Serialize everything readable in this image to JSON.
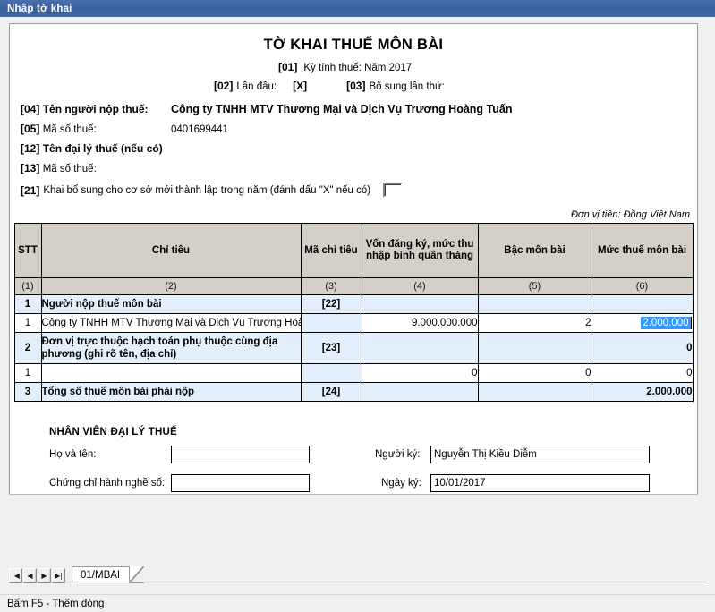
{
  "window": {
    "title": "Nhập tờ khai"
  },
  "form": {
    "title": "TỜ KHAI THUẾ MÔN BÀI",
    "line01": {
      "code": "[01]",
      "text": "Kỳ tính thuế: Năm 2017"
    },
    "line02": {
      "code": "[02]",
      "label": "Lần đầu:",
      "value": "[X]",
      "code03": "[03]",
      "label03": "Bổ sung lần thứ:",
      "value03": ""
    },
    "rows": [
      {
        "code": "[04]",
        "label": "Tên người nộp thuế:",
        "value": "Công ty TNHH MTV Thương Mại và Dịch Vụ Trương Hoàng Tuấn",
        "bold_label": true,
        "bold_value": true
      },
      {
        "code": "[05]",
        "label": "Mã số thuế:",
        "value": "0401699441",
        "bold_label": false,
        "bold_value": false
      },
      {
        "code": "[12]",
        "label": "Tên đại lý thuế (nếu có)",
        "value": "",
        "bold_label": true,
        "bold_value": false
      },
      {
        "code": "[13]",
        "label": "Mã số thuế:",
        "value": "",
        "bold_label": false,
        "bold_value": false
      }
    ],
    "row21": {
      "code": "[21]",
      "text": "Khai bổ sung cho cơ sở mới thành lập trong năm (đánh dấu \"X\" nếu có)",
      "checked": false
    },
    "currency_note": "Đơn vị tiền: Đồng Việt Nam"
  },
  "table": {
    "headers": [
      "STT",
      "Chỉ tiêu",
      "Mã chỉ tiêu",
      "Vốn đăng ký, mức thu nhập bình quân tháng",
      "Bậc môn bài",
      "Mức thuế môn bài"
    ],
    "numbering": [
      "(1)",
      "(2)",
      "(3)",
      "(4)",
      "(5)",
      "(6)"
    ],
    "rows": [
      {
        "kind": "group",
        "stt": "1",
        "name": "Người nộp thuế môn bài",
        "code": "[22]",
        "capital": "",
        "grade": "",
        "tax": ""
      },
      {
        "kind": "detail",
        "stt": "1",
        "name": "Công ty TNHH MTV Thương Mại và Dịch Vụ Trương Hoàng Tuấn",
        "code": "",
        "capital": "9.000.000.000",
        "grade": "2",
        "tax": "2.000.000",
        "selected": true
      },
      {
        "kind": "group-tall",
        "stt": "2",
        "name": "Đơn vị trực thuộc hạch toán phụ thuộc cùng địa phương (ghi rõ tên, địa chỉ)",
        "code": "[23]",
        "capital": "",
        "grade": "",
        "tax": "0"
      },
      {
        "kind": "detail",
        "stt": "1",
        "name": "",
        "code": "",
        "capital": "0",
        "grade": "0",
        "tax": "0"
      },
      {
        "kind": "total",
        "stt": "3",
        "name": "Tổng số thuế môn bài phải nộp",
        "code": "[24]",
        "capital": "",
        "grade": "",
        "tax": "2.000.000"
      }
    ]
  },
  "agent": {
    "heading": "NHÂN VIÊN ĐẠI LÝ THUẾ",
    "name_label": "Họ và tên:",
    "name_value": "",
    "cert_label": "Chứng chỉ hành nghề số:",
    "cert_value": "",
    "signer_label": "Người ký:",
    "signer_value": "Nguyễn Thị Kiều Diễm",
    "date_label": "Ngày ký:",
    "date_value": "10/01/2017"
  },
  "navigator": {
    "first_icon": "|◀",
    "prev_icon": "◀",
    "next_icon": "▶",
    "last_icon": "▶|",
    "tab_label": "01/MBAI"
  },
  "status": {
    "text": "Bấm F5 - Thêm dòng"
  },
  "colors": {
    "titlebar": "#41689f",
    "header_fill": "#d4d0c8",
    "group_fill": "#e3effb",
    "selection": "#3399ff"
  }
}
